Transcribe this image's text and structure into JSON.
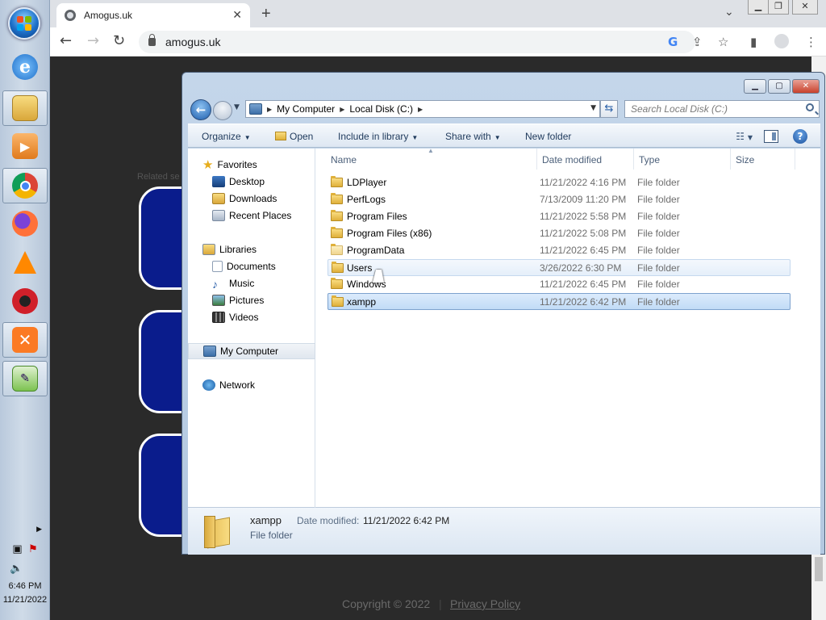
{
  "taskbar": {
    "apps": [
      {
        "name": "internet-explorer-icon",
        "color": "#2a7fd4"
      },
      {
        "name": "file-explorer-icon",
        "color": "#e9b94a"
      },
      {
        "name": "media-player-icon",
        "color": "#e9862a"
      },
      {
        "name": "chrome-icon",
        "color": "#db4437"
      },
      {
        "name": "firefox-icon",
        "color": "#ff7139"
      },
      {
        "name": "vlc-icon",
        "color": "#ff8800"
      },
      {
        "name": "red-circle-app-icon",
        "color": "#c8102e"
      },
      {
        "name": "xampp-icon",
        "color": "#fb7a24"
      },
      {
        "name": "editor-icon",
        "color": "#5aa832"
      }
    ],
    "time": "6:46 PM",
    "date": "11/21/2022"
  },
  "browser": {
    "tab_title": "Amogus.uk",
    "tab_close": "✕",
    "new_tab": "+",
    "url": "amogus.uk",
    "related_text": "Related se",
    "footer_copyright": "Copyright © 2022",
    "footer_privacy": "Privacy Policy"
  },
  "explorer": {
    "breadcrumb": [
      "My Computer",
      "Local Disk (C:)"
    ],
    "search_placeholder": "Search Local Disk (C:)",
    "commands": {
      "organize": "Organize",
      "open": "Open",
      "include_in_library": "Include in library",
      "share_with": "Share with",
      "new_folder": "New folder"
    },
    "nav": {
      "favorites": "Favorites",
      "desktop": "Desktop",
      "downloads": "Downloads",
      "recent_places": "Recent Places",
      "libraries": "Libraries",
      "documents": "Documents",
      "music": "Music",
      "pictures": "Pictures",
      "videos": "Videos",
      "my_computer": "My Computer",
      "network": "Network"
    },
    "columns": {
      "name": "Name",
      "date_modified": "Date modified",
      "type": "Type",
      "size": "Size"
    },
    "rows": [
      {
        "name": "LDPlayer",
        "date": "11/21/2022 4:16 PM",
        "type": "File folder"
      },
      {
        "name": "PerfLogs",
        "date": "7/13/2009 11:20 PM",
        "type": "File folder"
      },
      {
        "name": "Program Files",
        "date": "11/21/2022 5:58 PM",
        "type": "File folder"
      },
      {
        "name": "Program Files (x86)",
        "date": "11/21/2022 5:08 PM",
        "type": "File folder"
      },
      {
        "name": "ProgramData",
        "date": "11/21/2022 6:45 PM",
        "type": "File folder"
      },
      {
        "name": "Users",
        "date": "3/26/2022 6:30 PM",
        "type": "File folder"
      },
      {
        "name": "Windows",
        "date": "11/21/2022 6:45 PM",
        "type": "File folder"
      },
      {
        "name": "xampp",
        "date": "11/21/2022 6:42 PM",
        "type": "File folder"
      }
    ],
    "details": {
      "name": "xampp",
      "date_label": "Date modified:",
      "date_value": "11/21/2022 6:42 PM",
      "type": "File folder"
    }
  }
}
